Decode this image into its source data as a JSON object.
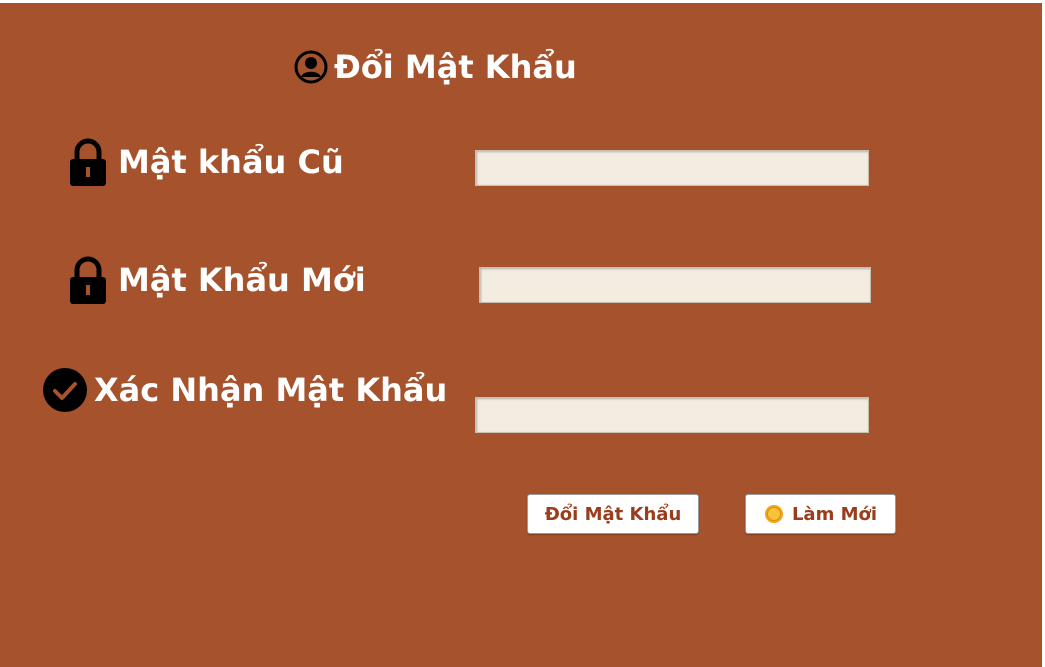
{
  "colors": {
    "panel_background": "#a5522d",
    "text": "#ffffff",
    "input_background": "#f3ede1",
    "button_text": "#9a3d1d"
  },
  "header": {
    "title": "Đổi Mật Khẩu",
    "icon": "user-circle-icon"
  },
  "fields": [
    {
      "label": "Mật khẩu Cũ",
      "icon": "lock-icon",
      "value": ""
    },
    {
      "label": "Mật Khẩu Mới",
      "icon": "lock-icon",
      "value": ""
    },
    {
      "label": "Xác Nhận Mật Khẩu",
      "icon": "check-circle-icon",
      "value": ""
    }
  ],
  "buttons": {
    "change_password": "Đổi Mật Khẩu",
    "refresh": "Làm Mới",
    "refresh_icon": "coin-icon"
  }
}
